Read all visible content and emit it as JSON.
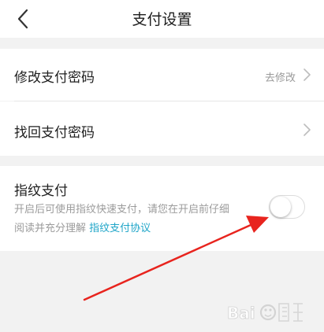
{
  "header": {
    "title": "支付设置",
    "back_icon": "chevron-left-icon"
  },
  "settings": {
    "change_password": {
      "label": "修改支付密码",
      "hint": "去修改"
    },
    "retrieve_password": {
      "label": "找回支付密码"
    },
    "fingerprint": {
      "label": "指纹支付",
      "desc_line1": "开启后可使用指纹快速支付，请您在开启前仔细",
      "desc_line2": "阅读并充分理解",
      "agreement_link": "指纹支付协议",
      "enabled": false
    }
  },
  "colors": {
    "link": "#1ea5c8",
    "annotation_arrow": "#e8241e"
  }
}
